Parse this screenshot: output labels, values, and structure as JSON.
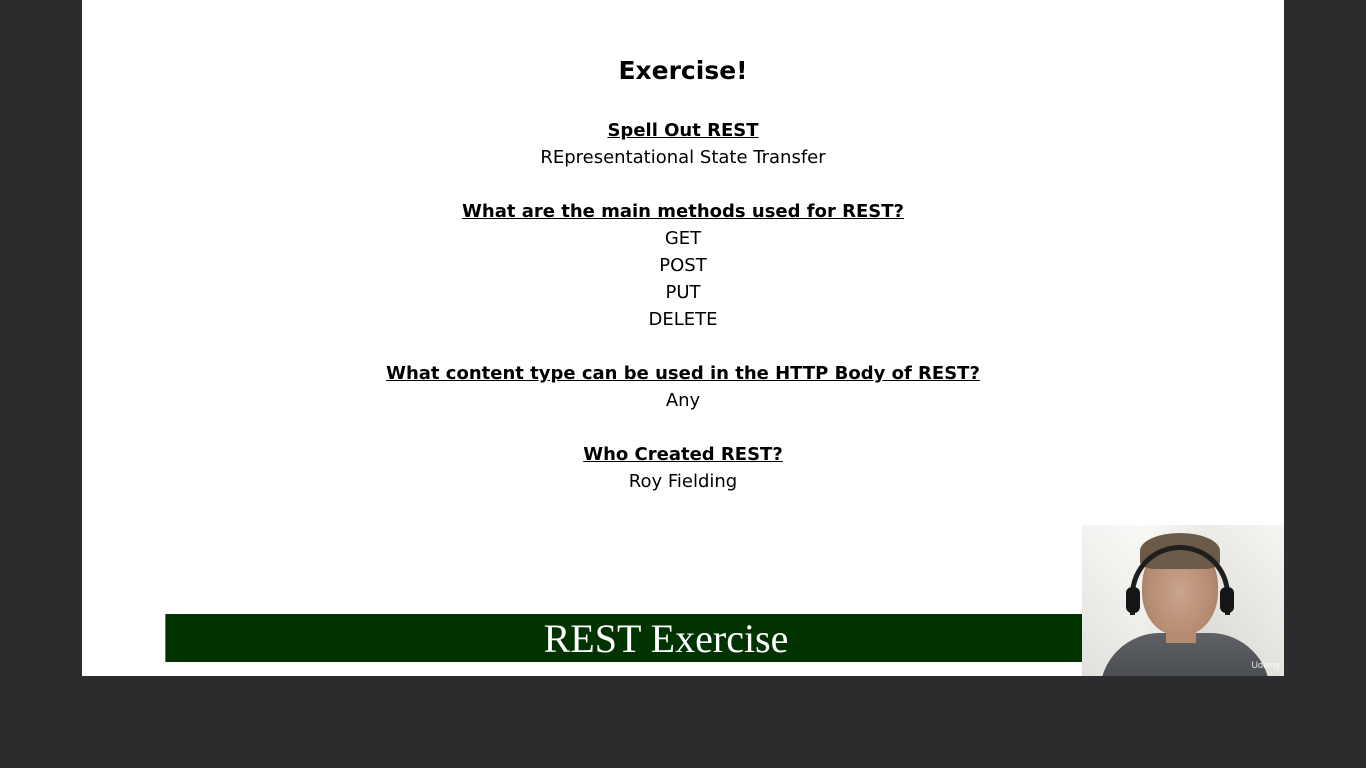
{
  "slide": {
    "title": "Exercise!",
    "sections": [
      {
        "question": "Spell Out REST",
        "answers": [
          "REpresentational State Transfer"
        ]
      },
      {
        "question": "What are the main methods used for REST?",
        "answers": [
          "GET",
          "POST",
          "PUT",
          "DELETE"
        ]
      },
      {
        "question": "What content type can be used in the HTTP Body of REST?",
        "answers": [
          "Any"
        ]
      },
      {
        "question": "Who Created REST?",
        "answers": [
          "Roy Fielding"
        ]
      }
    ],
    "banner": "REST Exercise"
  },
  "webcam": {
    "watermark": "Udemy"
  },
  "colors": {
    "background": "#2b2c2e",
    "slide": "#ffffff",
    "banner": "#003300",
    "banner_text": "#ffffff"
  }
}
